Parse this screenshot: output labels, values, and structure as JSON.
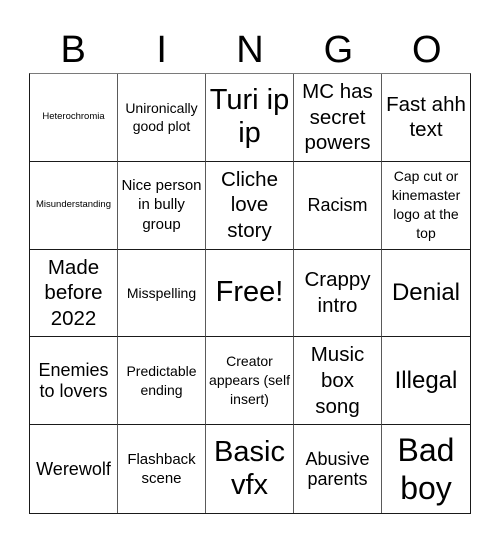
{
  "header": {
    "letters": [
      "B",
      "I",
      "N",
      "G",
      "O"
    ]
  },
  "card": {
    "rows": [
      [
        "Heterochromia",
        "Unironically good plot",
        "Turi ip ip",
        "MC has secret powers",
        "Fast ahh text"
      ],
      [
        "Misunderstanding",
        "Nice person in bully group",
        "Cliche love story",
        "Racism",
        "Cap cut or kinemaster logo at the top"
      ],
      [
        "Made before 2022",
        "Misspelling",
        "Free!",
        "Crappy intro",
        "Denial"
      ],
      [
        "Enemies to lovers",
        "Predictable ending",
        "Creator appears (self insert)",
        "Music box song",
        "Illegal"
      ],
      [
        "Werewolf",
        "Flashback scene",
        "Basic vfx",
        "Abusive parents",
        "Bad boy"
      ]
    ]
  }
}
